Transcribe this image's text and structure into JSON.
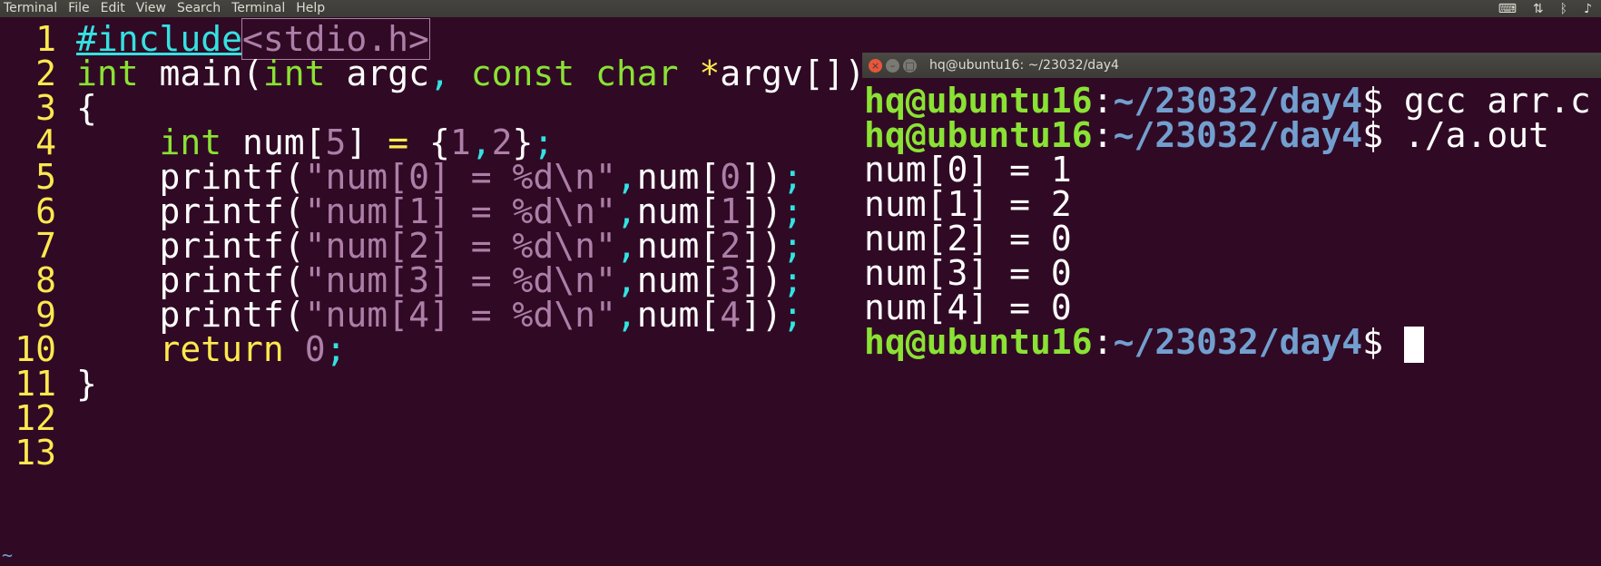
{
  "menubar": {
    "items": [
      "Terminal",
      "File",
      "Edit",
      "View",
      "Search",
      "Terminal",
      "Help"
    ],
    "tray_icons": [
      "keyboard-icon",
      "network-arrows-icon",
      "bluetooth-icon",
      "volume-icon"
    ]
  },
  "editor": {
    "line_numbers": [
      "1",
      "2",
      "3",
      "4",
      "5",
      "6",
      "7",
      "8",
      "9",
      "10",
      "11",
      "12",
      "13"
    ],
    "lines": {
      "l1": {
        "pp": "#include",
        "inc": "<stdio.h>"
      },
      "l2": {
        "t1": "int",
        "t2": " main(",
        "t3": "int",
        "t4": " argc",
        "t5": ",",
        "t6": " const",
        "t7": " char",
        "t8": " *",
        "t9": "argv[])"
      },
      "l3": {
        "t1": "{"
      },
      "l4": {
        "indent": "    ",
        "t1": "int",
        "t2": " num[",
        "t3": "5",
        "t4": "] ",
        "t5": "=",
        "t6": " {",
        "t7": "1",
        "t8": ",",
        "t9": "2",
        "t10": "}",
        "t11": ";"
      },
      "printf_lines": [
        {
          "idx": "0"
        },
        {
          "idx": "1"
        },
        {
          "idx": "2"
        },
        {
          "idx": "3"
        },
        {
          "idx": "4"
        }
      ],
      "printf_fn": "printf(",
      "printf_str_open": "\"num[",
      "printf_str_close": "] = %d\\n\"",
      "printf_comma": ",",
      "printf_arr": "num[",
      "printf_end": "])",
      "printf_semi": ";",
      "l10": {
        "t1": "return",
        "t2": " ",
        "t3": "0",
        "t4": ";"
      },
      "l11": {
        "t1": "}"
      }
    },
    "tilde": "~"
  },
  "terminal": {
    "title": "hq@ubuntu16: ~/23032/day4",
    "close_glyph": "×",
    "min_glyph": "–",
    "max_glyph": "□",
    "prompt_user": "hq@ubuntu16",
    "prompt_colon": ":",
    "prompt_path": "~/23032/day4",
    "prompt_dollar": "$ ",
    "cmd1": "gcc arr.c",
    "cmd2": "./a.out",
    "output": [
      "num[0] = 1",
      "num[1] = 2",
      "num[2] = 0",
      "num[3] = 0",
      "num[4] = 0"
    ]
  }
}
